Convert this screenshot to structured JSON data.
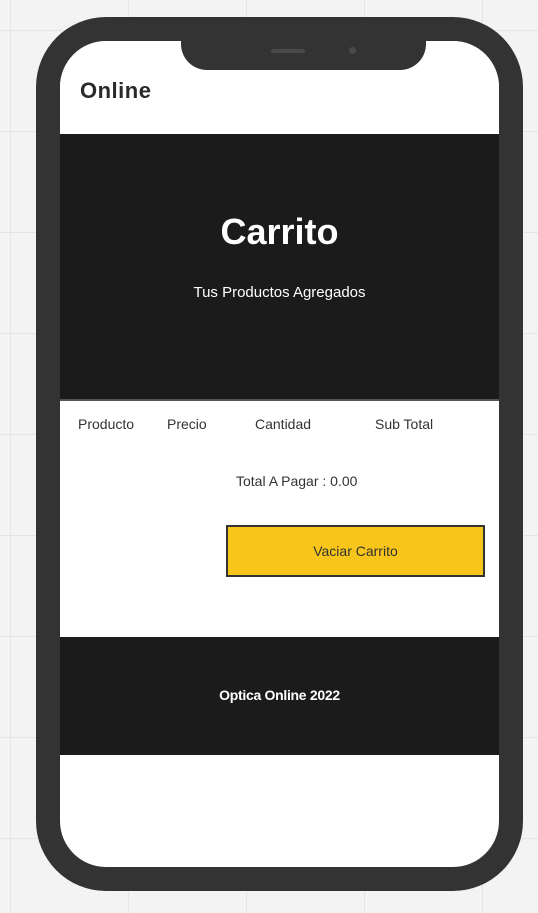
{
  "header": {
    "brand": "Online"
  },
  "hero": {
    "title": "Carrito",
    "subtitle": "Tus Productos Agregados"
  },
  "cart": {
    "columns": [
      "Producto",
      "Precio",
      "Cantidad",
      "Sub Total"
    ],
    "total_label": "Total A Pagar : ",
    "total_value": "0.00",
    "empty_button": "Vaciar Carrito"
  },
  "footer": {
    "text": "Optica Online 2022"
  },
  "colors": {
    "dark": "#1b1b1b",
    "accent": "#f8c51a",
    "phone_frame": "#333333"
  }
}
